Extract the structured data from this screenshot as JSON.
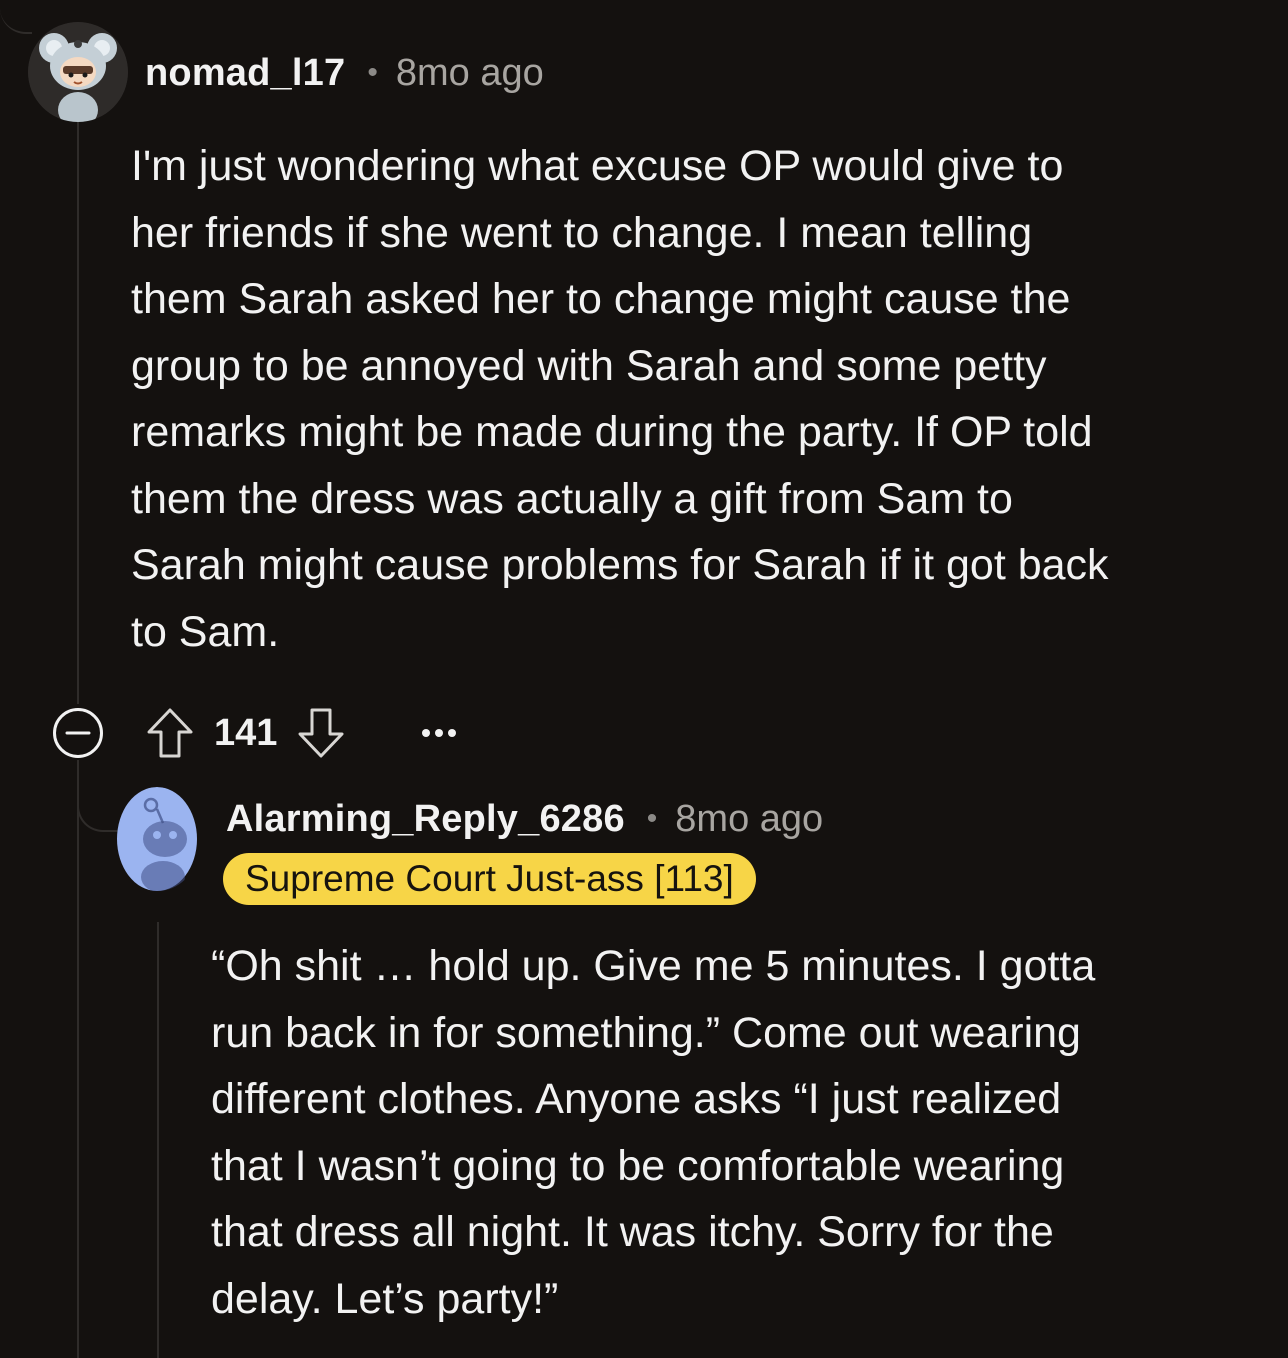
{
  "comments": [
    {
      "username": "nomad_l17",
      "separator": "•",
      "time": "8mo ago",
      "lines": [
        "I'm just wondering what excuse OP would give to",
        "her friends if she went to change. I mean telling",
        "them Sarah asked her to change might cause the",
        "group to be annoyed with Sarah and some petty",
        "remarks might be made during the party. If OP told",
        "them the dress was actually a gift from Sam to",
        "Sarah might cause problems for Sarah if it got back",
        "to Sam."
      ],
      "score": "141",
      "more_label": "•••"
    },
    {
      "username": "Alarming_Reply_6286",
      "separator": "•",
      "time": "8mo ago",
      "flair": "Supreme Court Just-ass [113]",
      "lines": [
        "“Oh shit … hold up. Give me 5 minutes. I gotta",
        "run back in for something.” Come out wearing",
        "different clothes. Anyone asks “I just realized",
        "that I wasn’t going to be comfortable wearing",
        "that dress all night. It was itchy. Sorry for the",
        "delay. Let’s party!”"
      ]
    }
  ],
  "colors": {
    "background": "#14110f",
    "thread_line": "#2f2c2a",
    "flair_bg": "#f7d547",
    "muted_text": "#a8a5a1",
    "snoo_avatar_bg": "#9bb4f0"
  },
  "icons": [
    "collapse-icon",
    "upvote-icon",
    "downvote-icon",
    "more-options-icon"
  ]
}
